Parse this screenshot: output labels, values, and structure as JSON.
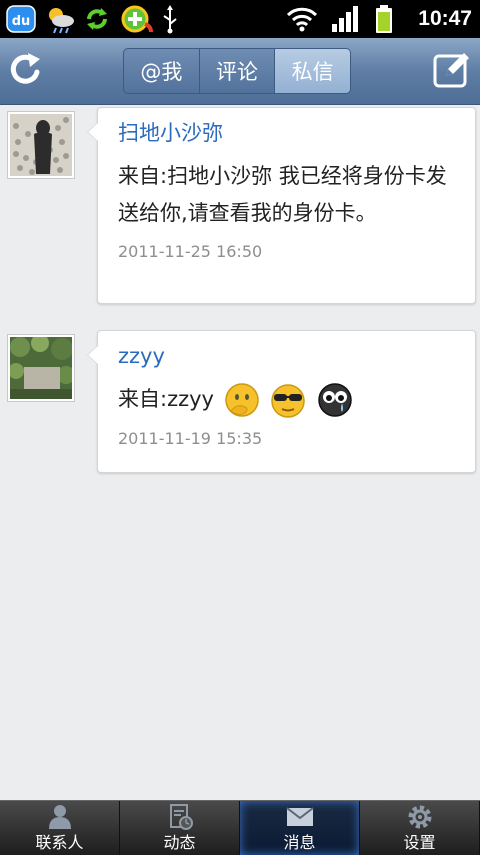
{
  "status_bar": {
    "time": "10:47",
    "left_icons": [
      "baidu-du-icon",
      "weather-icon",
      "sync-icon",
      "plus-app-icon",
      "usb-icon"
    ],
    "right_icons": [
      "wifi-icon",
      "signal-icon",
      "battery-icon"
    ],
    "baidu_text": "du"
  },
  "header": {
    "tabs": [
      {
        "label": "@我",
        "active": false
      },
      {
        "label": "评论",
        "active": false
      },
      {
        "label": "私信",
        "active": true
      }
    ],
    "left_icon": "refresh-icon",
    "right_icon": "compose-icon"
  },
  "messages": [
    {
      "username": "扫地小沙弥",
      "text": "来自:扫地小沙弥 我已经将身份卡发送给你,请查看我的身份卡。",
      "time": "2011-11-25 16:50"
    },
    {
      "username": "zzyy",
      "text": "来自:zzyy",
      "emojis": [
        "thinking-emoji-icon",
        "cool-emoji-icon",
        "crying-emoji-icon"
      ],
      "time": "2011-11-19 15:35"
    }
  ],
  "tabbar": {
    "items": [
      {
        "label": "联系人",
        "icon": "contacts-icon",
        "active": false
      },
      {
        "label": "动态",
        "icon": "feed-icon",
        "active": false
      },
      {
        "label": "消息",
        "icon": "mail-icon",
        "active": true
      },
      {
        "label": "设置",
        "icon": "settings-icon",
        "active": false
      }
    ]
  },
  "colors": {
    "header": "#5f7ea5",
    "username": "#2a6bbd",
    "timestamp": "#8e8e8e",
    "active_tab_glow": "#3b72c9"
  }
}
